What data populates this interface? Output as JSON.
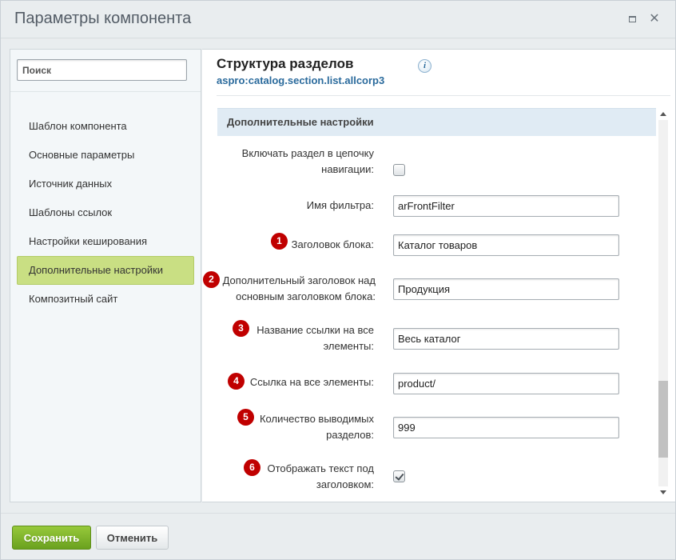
{
  "window": {
    "title": "Параметры компонента",
    "maximize_glyph": "",
    "close_glyph": "✕"
  },
  "sidebar": {
    "search_placeholder": "Поиск",
    "items": [
      {
        "label": "Шаблон компонента",
        "active": false
      },
      {
        "label": "Основные параметры",
        "active": false
      },
      {
        "label": "Источник данных",
        "active": false
      },
      {
        "label": "Шаблоны ссылок",
        "active": false
      },
      {
        "label": "Настройки кеширования",
        "active": false
      },
      {
        "label": "Дополнительные настройки",
        "active": true
      },
      {
        "label": "Композитный сайт",
        "active": false
      }
    ]
  },
  "component": {
    "title": "Структура разделов",
    "code": "aspro:catalog.section.list.allcorp3",
    "info_glyph": "i"
  },
  "section": {
    "title": "Дополнительные настройки",
    "fields": [
      {
        "label": "Включать раздел в цепочку навигации:",
        "type": "checkbox",
        "checked": false
      },
      {
        "label": "Имя фильтра:",
        "type": "text",
        "value": "arFrontFilter"
      },
      {
        "label": "Заголовок блока:",
        "type": "text",
        "value": "Каталог товаров",
        "marker": "1"
      },
      {
        "label": "Дополнительный заголовок над основным заголовком блока:",
        "type": "text",
        "value": "Продукция",
        "marker": "2"
      },
      {
        "label": "Название ссылки на все элементы:",
        "type": "text",
        "value": "Весь каталог",
        "marker": "3"
      },
      {
        "label": "Ссылка на все элементы:",
        "type": "text",
        "value": "product/",
        "marker": "4"
      },
      {
        "label": "Количество выводимых разделов:",
        "type": "text",
        "value": "999",
        "marker": "5"
      },
      {
        "label": "Отображать текст под заголовком:",
        "type": "checkbox",
        "checked": true,
        "marker": "6"
      }
    ]
  },
  "footer": {
    "save_label": "Сохранить",
    "cancel_label": "Отменить"
  },
  "colors": {
    "accent_green": "#7ab52a",
    "active_nav": "#c9df83",
    "section_header": "#e0ebf4",
    "marker_red": "#c00000",
    "link_blue": "#2a6a9c"
  },
  "icons": {
    "maximize": "maximize-icon",
    "close": "close-icon",
    "info": "info-icon"
  }
}
